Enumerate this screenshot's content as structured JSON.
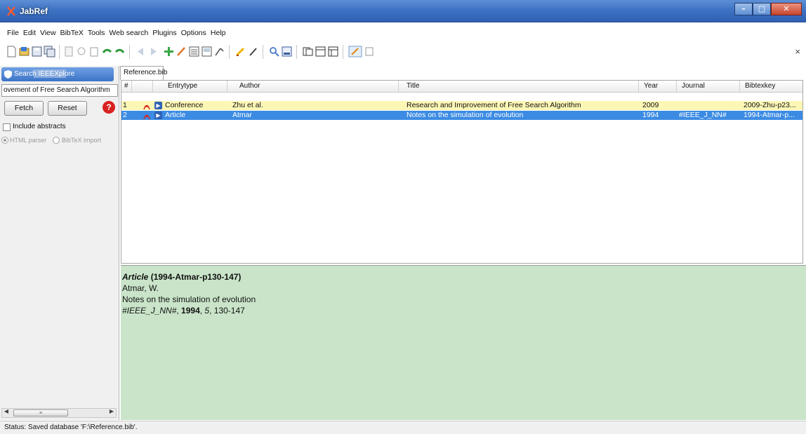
{
  "window": {
    "title": "JabRef"
  },
  "menubar": [
    "File",
    "Edit",
    "View",
    "BibTeX",
    "Tools",
    "Web search",
    "Plugins",
    "Options",
    "Help"
  ],
  "sidepanel": {
    "tab_label": "Search IEEEXplore",
    "search_value": "ovement of Free Search Algorithm",
    "fetch_label": "Fetch",
    "reset_label": "Reset",
    "include_abstracts_label": "Include abstracts",
    "html_parser_label": "HTML parser",
    "bibtex_import_label": "BibTeX import"
  },
  "doc_tab": "Reference.bib",
  "table": {
    "headers": {
      "num": "#",
      "entrytype": "Entrytype",
      "author": "Author",
      "title": "Title",
      "year": "Year",
      "journal": "Journal",
      "bibtexkey": "Bibtexkey"
    },
    "rows": [
      {
        "num": "1",
        "entrytype": "Conference",
        "author": "Zhu et al.",
        "title": "Research and Improvement of Free Search Algorithm",
        "year": "2009",
        "journal": "",
        "bibtexkey": "2009-Zhu-p23..."
      },
      {
        "num": "2",
        "entrytype": "Article",
        "author": "Atmar",
        "title": "Notes on the simulation of evolution",
        "year": "1994",
        "journal": "#IEEE_J_NN#",
        "bibtexkey": "1994-Atmar-p..."
      }
    ]
  },
  "preview": {
    "entry_type": "Article",
    "key": "(1994-Atmar-p130-147)",
    "author": "Atmar, W.",
    "title": "Notes on the simulation of evolution",
    "journal": "#IEEE_J_NN#",
    "year": "1994",
    "volume": "5",
    "pages": "130-147"
  },
  "status": {
    "text": "Status: Saved database 'F:\\Reference.bib'."
  },
  "colors": {
    "title_bar": "#3f73c4",
    "selected_row": "#3b8be3",
    "highlight_row": "#fdf7b6",
    "preview_bg": "#c9e4c9"
  }
}
